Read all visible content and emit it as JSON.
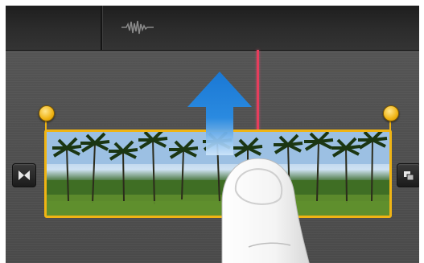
{
  "colors": {
    "accent_yellow": "#f0b414",
    "playhead_red": "#e63d5c",
    "arrow_blue": "#1c7ed6",
    "timeline_bg": "#4e4e4e"
  },
  "header": {
    "audio_icon": "audio-waveform-icon"
  },
  "clip": {
    "selected": true,
    "thumbnail": "palm-trees-landscape"
  },
  "controls": {
    "left_button_icon": "transition-bowtie-icon",
    "right_button_icon": "overlap-squares-icon"
  },
  "gesture": {
    "direction": "up",
    "hint_icon": "up-arrow-icon",
    "hand_icon": "finger-icon"
  }
}
